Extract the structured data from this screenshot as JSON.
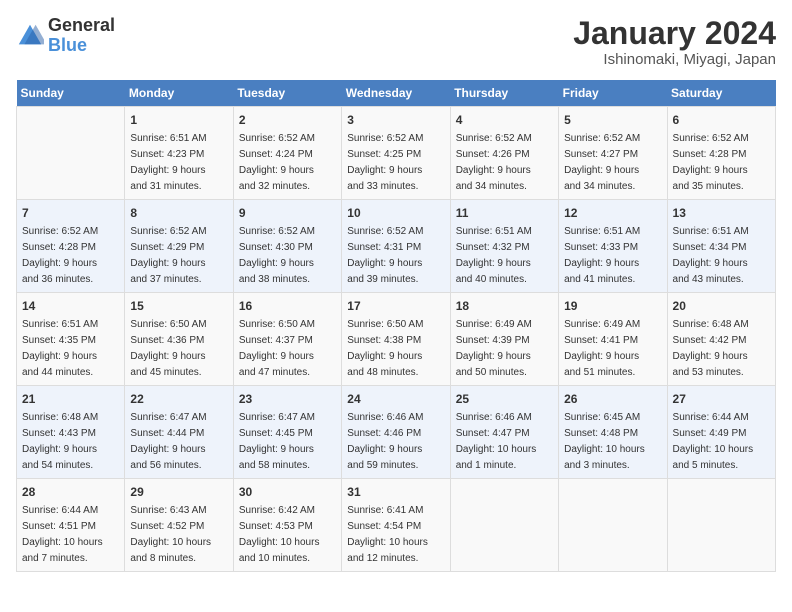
{
  "header": {
    "logo": {
      "text_general": "General",
      "text_blue": "Blue"
    },
    "title": "January 2024",
    "location": "Ishinomaki, Miyagi, Japan"
  },
  "calendar": {
    "days_of_week": [
      "Sunday",
      "Monday",
      "Tuesday",
      "Wednesday",
      "Thursday",
      "Friday",
      "Saturday"
    ],
    "weeks": [
      [
        {
          "day": "",
          "info": ""
        },
        {
          "day": "1",
          "info": "Sunrise: 6:51 AM\nSunset: 4:23 PM\nDaylight: 9 hours\nand 31 minutes."
        },
        {
          "day": "2",
          "info": "Sunrise: 6:52 AM\nSunset: 4:24 PM\nDaylight: 9 hours\nand 32 minutes."
        },
        {
          "day": "3",
          "info": "Sunrise: 6:52 AM\nSunset: 4:25 PM\nDaylight: 9 hours\nand 33 minutes."
        },
        {
          "day": "4",
          "info": "Sunrise: 6:52 AM\nSunset: 4:26 PM\nDaylight: 9 hours\nand 34 minutes."
        },
        {
          "day": "5",
          "info": "Sunrise: 6:52 AM\nSunset: 4:27 PM\nDaylight: 9 hours\nand 34 minutes."
        },
        {
          "day": "6",
          "info": "Sunrise: 6:52 AM\nSunset: 4:28 PM\nDaylight: 9 hours\nand 35 minutes."
        }
      ],
      [
        {
          "day": "7",
          "info": "Sunrise: 6:52 AM\nSunset: 4:28 PM\nDaylight: 9 hours\nand 36 minutes."
        },
        {
          "day": "8",
          "info": "Sunrise: 6:52 AM\nSunset: 4:29 PM\nDaylight: 9 hours\nand 37 minutes."
        },
        {
          "day": "9",
          "info": "Sunrise: 6:52 AM\nSunset: 4:30 PM\nDaylight: 9 hours\nand 38 minutes."
        },
        {
          "day": "10",
          "info": "Sunrise: 6:52 AM\nSunset: 4:31 PM\nDaylight: 9 hours\nand 39 minutes."
        },
        {
          "day": "11",
          "info": "Sunrise: 6:51 AM\nSunset: 4:32 PM\nDaylight: 9 hours\nand 40 minutes."
        },
        {
          "day": "12",
          "info": "Sunrise: 6:51 AM\nSunset: 4:33 PM\nDaylight: 9 hours\nand 41 minutes."
        },
        {
          "day": "13",
          "info": "Sunrise: 6:51 AM\nSunset: 4:34 PM\nDaylight: 9 hours\nand 43 minutes."
        }
      ],
      [
        {
          "day": "14",
          "info": "Sunrise: 6:51 AM\nSunset: 4:35 PM\nDaylight: 9 hours\nand 44 minutes."
        },
        {
          "day": "15",
          "info": "Sunrise: 6:50 AM\nSunset: 4:36 PM\nDaylight: 9 hours\nand 45 minutes."
        },
        {
          "day": "16",
          "info": "Sunrise: 6:50 AM\nSunset: 4:37 PM\nDaylight: 9 hours\nand 47 minutes."
        },
        {
          "day": "17",
          "info": "Sunrise: 6:50 AM\nSunset: 4:38 PM\nDaylight: 9 hours\nand 48 minutes."
        },
        {
          "day": "18",
          "info": "Sunrise: 6:49 AM\nSunset: 4:39 PM\nDaylight: 9 hours\nand 50 minutes."
        },
        {
          "day": "19",
          "info": "Sunrise: 6:49 AM\nSunset: 4:41 PM\nDaylight: 9 hours\nand 51 minutes."
        },
        {
          "day": "20",
          "info": "Sunrise: 6:48 AM\nSunset: 4:42 PM\nDaylight: 9 hours\nand 53 minutes."
        }
      ],
      [
        {
          "day": "21",
          "info": "Sunrise: 6:48 AM\nSunset: 4:43 PM\nDaylight: 9 hours\nand 54 minutes."
        },
        {
          "day": "22",
          "info": "Sunrise: 6:47 AM\nSunset: 4:44 PM\nDaylight: 9 hours\nand 56 minutes."
        },
        {
          "day": "23",
          "info": "Sunrise: 6:47 AM\nSunset: 4:45 PM\nDaylight: 9 hours\nand 58 minutes."
        },
        {
          "day": "24",
          "info": "Sunrise: 6:46 AM\nSunset: 4:46 PM\nDaylight: 9 hours\nand 59 minutes."
        },
        {
          "day": "25",
          "info": "Sunrise: 6:46 AM\nSunset: 4:47 PM\nDaylight: 10 hours\nand 1 minute."
        },
        {
          "day": "26",
          "info": "Sunrise: 6:45 AM\nSunset: 4:48 PM\nDaylight: 10 hours\nand 3 minutes."
        },
        {
          "day": "27",
          "info": "Sunrise: 6:44 AM\nSunset: 4:49 PM\nDaylight: 10 hours\nand 5 minutes."
        }
      ],
      [
        {
          "day": "28",
          "info": "Sunrise: 6:44 AM\nSunset: 4:51 PM\nDaylight: 10 hours\nand 7 minutes."
        },
        {
          "day": "29",
          "info": "Sunrise: 6:43 AM\nSunset: 4:52 PM\nDaylight: 10 hours\nand 8 minutes."
        },
        {
          "day": "30",
          "info": "Sunrise: 6:42 AM\nSunset: 4:53 PM\nDaylight: 10 hours\nand 10 minutes."
        },
        {
          "day": "31",
          "info": "Sunrise: 6:41 AM\nSunset: 4:54 PM\nDaylight: 10 hours\nand 12 minutes."
        },
        {
          "day": "",
          "info": ""
        },
        {
          "day": "",
          "info": ""
        },
        {
          "day": "",
          "info": ""
        }
      ]
    ]
  }
}
